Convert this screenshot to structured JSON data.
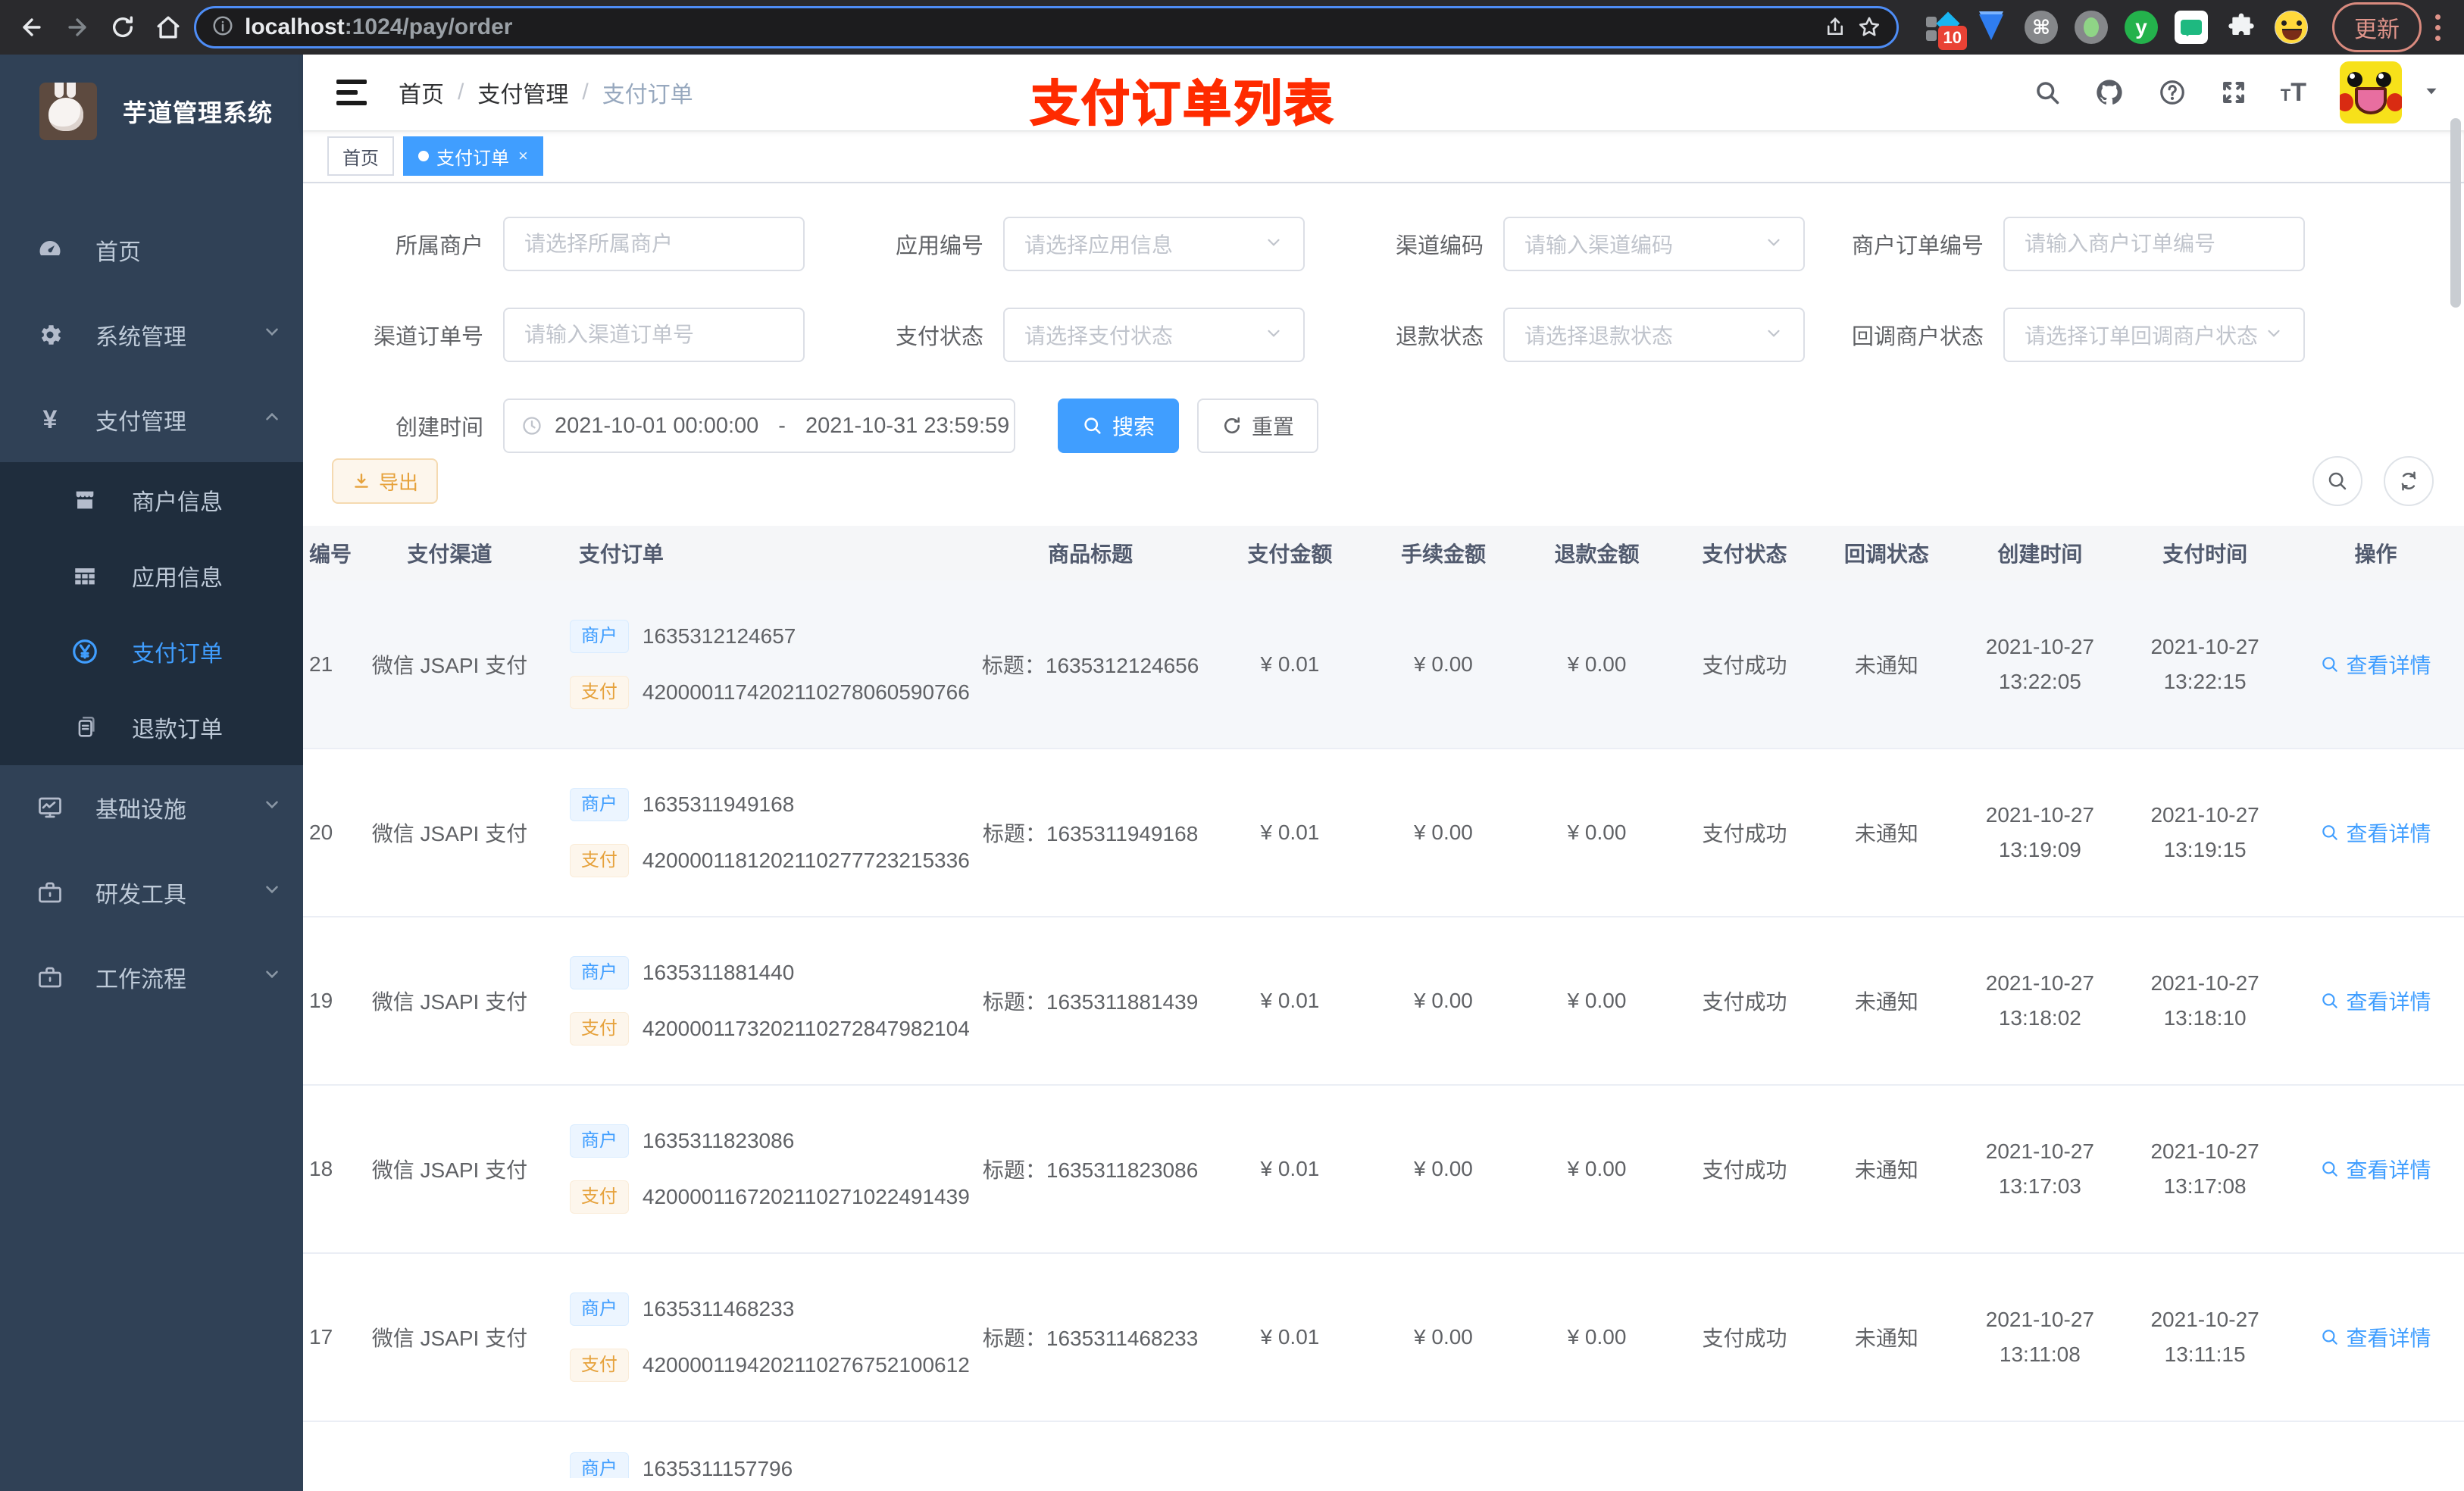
{
  "browser": {
    "url_host": "localhost",
    "url_rest": ":1024/pay/order",
    "extension_badge": "10",
    "update_label": "更新"
  },
  "sidebar": {
    "title": "芋道管理系统",
    "items": [
      {
        "label": "首页",
        "icon": "dashboard-icon"
      },
      {
        "label": "系统管理",
        "icon": "gear-icon",
        "state": "collapsed"
      },
      {
        "label": "支付管理",
        "icon": "yen-icon",
        "state": "expanded"
      },
      {
        "label": "商户信息",
        "icon": "shop-icon"
      },
      {
        "label": "应用信息",
        "icon": "grid-icon"
      },
      {
        "label": "支付订单",
        "icon": "yen-circle-icon",
        "state": "active"
      },
      {
        "label": "退款订单",
        "icon": "document-icon"
      },
      {
        "label": "基础设施",
        "icon": "monitor-icon",
        "state": "collapsed"
      },
      {
        "label": "研发工具",
        "icon": "briefcase-icon",
        "state": "collapsed"
      },
      {
        "label": "工作流程",
        "icon": "briefcase-icon",
        "state": "collapsed"
      }
    ]
  },
  "header": {
    "breadcrumb": [
      "首页",
      "支付管理",
      "支付订单"
    ],
    "annotation": "支付订单列表",
    "icons": [
      "search-icon",
      "github-icon",
      "help-icon",
      "fullscreen-icon",
      "font-size-icon",
      "avatar",
      "caret-down-icon"
    ]
  },
  "tabs": [
    {
      "label": "首页",
      "active": false
    },
    {
      "label": "支付订单",
      "active": true
    }
  ],
  "filters": {
    "merchant": {
      "label": "所属商户",
      "placeholder": "请选择所属商户"
    },
    "app": {
      "label": "应用编号",
      "placeholder": "请选择应用信息"
    },
    "channel_code": {
      "label": "渠道编码",
      "placeholder": "请输入渠道编码"
    },
    "merchant_order_no": {
      "label": "商户订单编号",
      "placeholder": "请输入商户订单编号"
    },
    "channel_order_no": {
      "label": "渠道订单号",
      "placeholder": "请输入渠道订单号"
    },
    "pay_status": {
      "label": "支付状态",
      "placeholder": "请选择支付状态"
    },
    "refund_status": {
      "label": "退款状态",
      "placeholder": "请选择退款状态"
    },
    "callback_status": {
      "label": "回调商户状态",
      "placeholder": "请选择订单回调商户状态"
    },
    "create_time": {
      "label": "创建时间",
      "start": "2021-10-01 00:00:00",
      "separator": "-",
      "end": "2021-10-31 23:59:59"
    },
    "search_label": "搜索",
    "reset_label": "重置"
  },
  "toolbar": {
    "export_label": "导出"
  },
  "table": {
    "columns": [
      "编号",
      "支付渠道",
      "支付订单",
      "商品标题",
      "支付金额",
      "手续金额",
      "退款金额",
      "支付状态",
      "回调状态",
      "创建时间",
      "支付时间",
      "操作"
    ],
    "merchant_tag": "商户",
    "pay_tag": "支付",
    "rows": [
      {
        "id": "21",
        "channel": "微信 JSAPI 支付",
        "merchant_no": "1635312124657",
        "pay_no": "4200001174202110278060590766",
        "title": "标题：1635312124656",
        "amount": "¥ 0.01",
        "fee": "¥ 0.00",
        "refund": "¥ 0.00",
        "status": "支付成功",
        "notify": "未通知",
        "create_date": "2021-10-27",
        "create_time": "13:22:05",
        "pay_date": "2021-10-27",
        "pay_time": "13:22:15",
        "detail": "查看详情"
      },
      {
        "id": "20",
        "channel": "微信 JSAPI 支付",
        "merchant_no": "1635311949168",
        "pay_no": "4200001181202110277723215336",
        "title": "标题：1635311949168",
        "amount": "¥ 0.01",
        "fee": "¥ 0.00",
        "refund": "¥ 0.00",
        "status": "支付成功",
        "notify": "未通知",
        "create_date": "2021-10-27",
        "create_time": "13:19:09",
        "pay_date": "2021-10-27",
        "pay_time": "13:19:15",
        "detail": "查看详情"
      },
      {
        "id": "19",
        "channel": "微信 JSAPI 支付",
        "merchant_no": "1635311881440",
        "pay_no": "4200001173202110272847982104",
        "title": "标题：1635311881439",
        "amount": "¥ 0.01",
        "fee": "¥ 0.00",
        "refund": "¥ 0.00",
        "status": "支付成功",
        "notify": "未通知",
        "create_date": "2021-10-27",
        "create_time": "13:18:02",
        "pay_date": "2021-10-27",
        "pay_time": "13:18:10",
        "detail": "查看详情"
      },
      {
        "id": "18",
        "channel": "微信 JSAPI 支付",
        "merchant_no": "1635311823086",
        "pay_no": "4200001167202110271022491439",
        "title": "标题：1635311823086",
        "amount": "¥ 0.01",
        "fee": "¥ 0.00",
        "refund": "¥ 0.00",
        "status": "支付成功",
        "notify": "未通知",
        "create_date": "2021-10-27",
        "create_time": "13:17:03",
        "pay_date": "2021-10-27",
        "pay_time": "13:17:08",
        "detail": "查看详情"
      },
      {
        "id": "17",
        "channel": "微信 JSAPI 支付",
        "merchant_no": "1635311468233",
        "pay_no": "4200001194202110276752100612",
        "title": "标题：1635311468233",
        "amount": "¥ 0.01",
        "fee": "¥ 0.00",
        "refund": "¥ 0.00",
        "status": "支付成功",
        "notify": "未通知",
        "create_date": "2021-10-27",
        "create_time": "13:11:08",
        "pay_date": "2021-10-27",
        "pay_time": "13:11:15",
        "detail": "查看详情"
      }
    ],
    "partial_row": {
      "merchant_no": "1635311157796"
    }
  }
}
